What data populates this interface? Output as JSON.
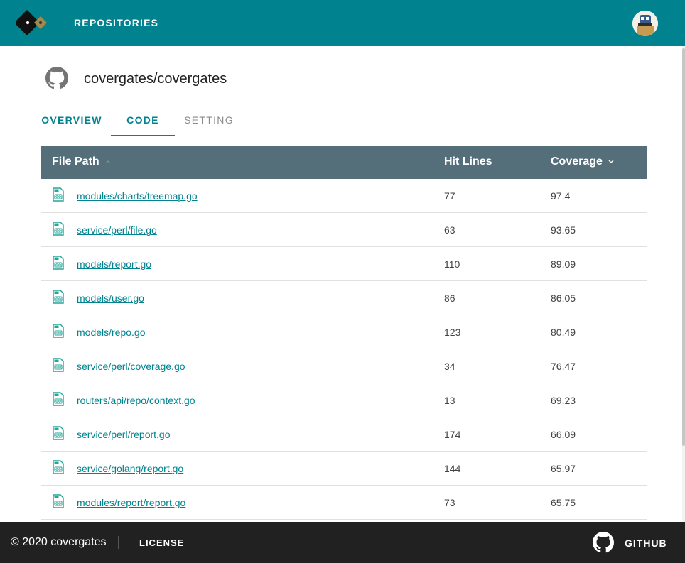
{
  "header": {
    "nav_label": "REPOSITORIES",
    "brand_color": "#00838f",
    "logo_icon": "covergates-logo-icon",
    "avatar_icon": "user-avatar-icon"
  },
  "repo": {
    "name": "covergates/covergates",
    "icon": "github-icon"
  },
  "tabs": [
    {
      "label": "OVERVIEW",
      "active": false
    },
    {
      "label": "CODE",
      "active": true
    },
    {
      "label": "SETTING",
      "active": false
    }
  ],
  "table": {
    "columns": {
      "path": "File Path",
      "hits": "Hit Lines",
      "coverage": "Coverage"
    },
    "sort": {
      "column": "coverage",
      "direction": "descending"
    },
    "header_color": "#546e7a",
    "file_icon": "go-file-icon",
    "rows": [
      {
        "path": "modules/charts/treemap.go",
        "hits": "77",
        "coverage": "97.4"
      },
      {
        "path": "service/perl/file.go",
        "hits": "63",
        "coverage": "93.65"
      },
      {
        "path": "models/report.go",
        "hits": "110",
        "coverage": "89.09"
      },
      {
        "path": "models/user.go",
        "hits": "86",
        "coverage": "86.05"
      },
      {
        "path": "models/repo.go",
        "hits": "123",
        "coverage": "80.49"
      },
      {
        "path": "service/perl/coverage.go",
        "hits": "34",
        "coverage": "76.47"
      },
      {
        "path": "routers/api/repo/context.go",
        "hits": "13",
        "coverage": "69.23"
      },
      {
        "path": "service/perl/report.go",
        "hits": "174",
        "coverage": "66.09"
      },
      {
        "path": "service/golang/report.go",
        "hits": "144",
        "coverage": "65.97"
      },
      {
        "path": "modules/report/report.go",
        "hits": "73",
        "coverage": "65.75"
      }
    ]
  },
  "footer": {
    "copyright": "© 2020 covergates",
    "license": "LICENSE",
    "github": "GITHUB",
    "github_icon": "github-icon"
  }
}
